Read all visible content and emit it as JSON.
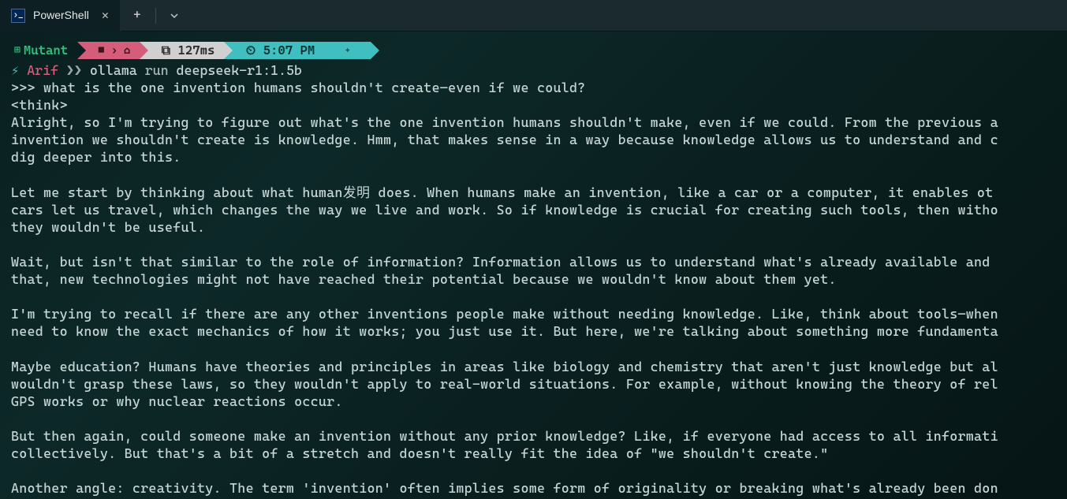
{
  "tab": {
    "title": "PowerShell"
  },
  "prompt": {
    "host": "Mutant",
    "folder_icon": "📁",
    "home_icon": "🏠",
    "duration": "127ms",
    "time": "5:07 PM"
  },
  "command": {
    "lightning": "⚡",
    "user": "Arif",
    "arrows": "❯❯",
    "executable": "ollama",
    "verb": "run",
    "model": "deepseek-r1:1.5b"
  },
  "output": {
    "lines": [
      ">>> what is the one invention humans shouldn't create—even if we could?",
      "<think>",
      "Alright, so I'm trying to figure out what's the one invention humans shouldn't make, even if we could. From the previous a",
      "invention we shouldn't create is knowledge. Hmm, that makes sense in a way because knowledge allows us to understand and c",
      "dig deeper into this.",
      "",
      "Let me start by thinking about what human发明 does. When humans make an invention, like a car or a computer, it enables ot",
      "cars let us travel, which changes the way we live and work. So if knowledge is crucial for creating such tools, then witho",
      "they wouldn't be useful.",
      "",
      "Wait, but isn't that similar to the role of information? Information allows us to understand what's already available and ",
      "that, new technologies might not have reached their potential because we wouldn't know about them yet.",
      "",
      "I'm trying to recall if there are any other inventions people make without needing knowledge. Like, think about tools—when",
      "need to know the exact mechanics of how it works; you just use it. But here, we're talking about something more fundamenta",
      "",
      "Maybe education? Humans have theories and principles in areas like biology and chemistry that aren't just knowledge but al",
      "wouldn't grasp these laws, so they wouldn't apply to real-world situations. For example, without knowing the theory of rel",
      "GPS works or why nuclear reactions occur.",
      "",
      "But then again, could someone make an invention without any prior knowledge? Like, if everyone had access to all informati",
      "collectively. But that's a bit of a stretch and doesn't really fit the idea of \"we shouldn't create.\"",
      "",
      "Another angle: creativity. The term 'invention' often implies some form of originality or breaking what's already been don"
    ]
  }
}
